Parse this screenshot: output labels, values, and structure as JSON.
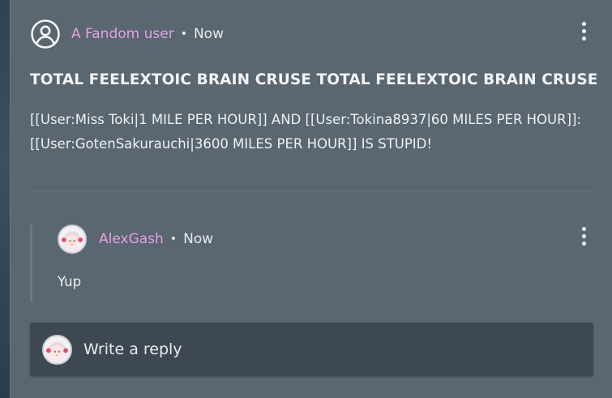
{
  "post": {
    "author": "A Fandom user",
    "separator": "•",
    "time": "Now",
    "title": "TOTAL FEELEXTOIC BRAIN CRUSE TOTAL FEELEXTOIC BRAIN CRUSE",
    "body_line1": "[[User:Miss Toki|1 MILE PER HOUR]] AND [[User:Tokina8937|60 MILES PER HOUR]]:",
    "body_line2": "[[User:GotenSakurauchi|3600 MILES PER HOUR]] IS STUPID!"
  },
  "reply": {
    "author": "AlexGash",
    "separator": "•",
    "time": "Now",
    "text": "Yup"
  },
  "reply_box": {
    "placeholder": "Write a reply"
  },
  "icons": {
    "user": "user-circle-icon",
    "more": "more-vertical-icon",
    "avatar": "anime-avatar"
  },
  "colors": {
    "card": "#5a6670",
    "author_link": "#e6a1e6",
    "reply_box": "#3d4852",
    "text": "#eef1f3"
  }
}
